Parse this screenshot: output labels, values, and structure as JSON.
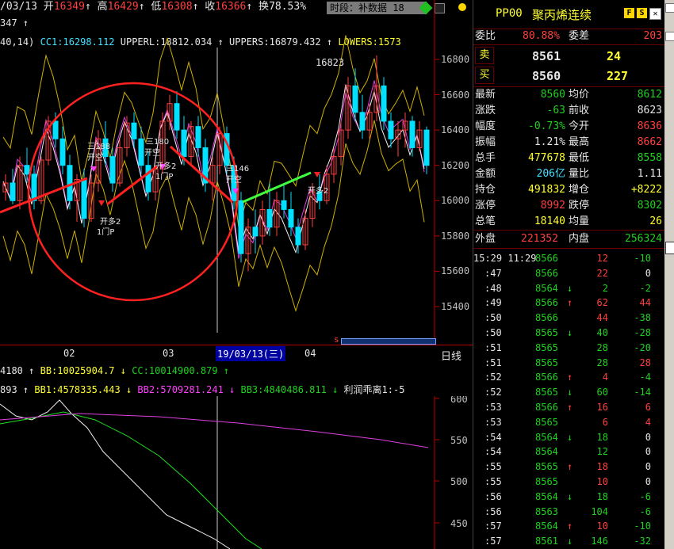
{
  "header": {
    "date": "/03/13",
    "open_label": "开",
    "open": "16349",
    "open_arrow": "↑",
    "high_label": "高",
    "high": "16429",
    "high_arrow": "↑",
    "low_label": "低",
    "low": "16308",
    "low_arrow": "↑",
    "close_label": "收",
    "close": "16366",
    "close_arrow": "↑",
    "turnover_label": "换",
    "turnover": "78.53%",
    "overlay_text": "时段：补数据",
    "overlay_tail": "18"
  },
  "indicator_line": {
    "left_num": "347 ↑",
    "params": "40,14)",
    "cc1": "CC1:16298.112",
    "upperl": "UPPERL:18812.034",
    "uppers": "UPPERS:16879.432",
    "lowers": "LOWERS:1573"
  },
  "price_axis": {
    "ticks": [
      "16800",
      "16600",
      "16400",
      "16200",
      "16000",
      "15800",
      "15600",
      "15400"
    ]
  },
  "chart_annotations": {
    "peak_label": "16823",
    "marks": [
      "三188",
      "开空",
      "开多2",
      "1门P",
      "三180",
      "开空",
      "开多2",
      "1门P",
      "三146",
      "开空",
      "开多2"
    ]
  },
  "date_axis": {
    "labels": [
      "02",
      "03",
      "19/03/13(三)",
      "04"
    ],
    "period_label": "日线"
  },
  "lower_header_1": {
    "left": "4180 ↑",
    "bb": "BB:10025904.7 ↓",
    "cc": "CC:10014900.879 ↑"
  },
  "lower_header_2": {
    "left": "893 ↑",
    "bb1": "BB1:4578335.443 ↓",
    "bb2": "BB2:5709281.241 ↓",
    "bb3": "BB3:4840486.811 ↓",
    "lr": "利润乖离1:-5"
  },
  "lower_axis": {
    "ticks": [
      "600",
      "550",
      "500",
      "450"
    ]
  },
  "panel": {
    "symbol": "PP00",
    "name": "聚丙烯连续",
    "btn_f": "F",
    "btn_s": "S",
    "ratio_label": "委比",
    "ratio": "80.88%",
    "diff_label": "委差",
    "diff": "203",
    "sell_label": "卖",
    "sell_price": "8561",
    "sell_qty": "24",
    "buy_label": "买",
    "buy_price": "8560",
    "buy_qty": "227",
    "stats": [
      {
        "l1": "最新",
        "v1": "8560",
        "l2": "均价",
        "v2": "8612",
        "c1": "green",
        "c2": "green"
      },
      {
        "l1": "涨跌",
        "v1": "-63",
        "l2": "前收",
        "v2": "8623",
        "c1": "green",
        "c2": "white"
      },
      {
        "l1": "幅度",
        "v1": "-0.73%",
        "l2": "今开",
        "v2": "8636",
        "c1": "green",
        "c2": "red"
      },
      {
        "l1": "振幅",
        "v1": "1.21%",
        "l2": "最高",
        "v2": "8662",
        "c1": "white",
        "c2": "red"
      },
      {
        "l1": "总手",
        "v1": "477678",
        "l2": "最低",
        "v2": "8558",
        "c1": "yellow",
        "c2": "green"
      },
      {
        "l1": "金额",
        "v1": "206亿",
        "l2": "量比",
        "v2": "1.11",
        "c1": "cyan",
        "c2": "white"
      },
      {
        "l1": "持仓",
        "v1": "491832",
        "l2": "增仓",
        "v2": "+8222",
        "c1": "yellow",
        "c2": "yellow"
      },
      {
        "l1": "涨停",
        "v1": "8992",
        "l2": "跌停",
        "v2": "8302",
        "c1": "red",
        "c2": "green"
      },
      {
        "l1": "总笔",
        "v1": "18140",
        "l2": "均量",
        "v2": "26",
        "c1": "yellow",
        "c2": "yellow"
      }
    ],
    "outer_label": "外盘",
    "outer": "221352",
    "inner_label": "内盘",
    "inner": "256324",
    "ticks": [
      {
        "t": "15:29 11:29",
        "p": "8566",
        "arrow": "",
        "v": "12",
        "d": "-10",
        "pc": "green",
        "vc": "red",
        "dc": "green"
      },
      {
        "t": ":47",
        "p": "8566",
        "arrow": "",
        "v": "22",
        "d": "0",
        "pc": "green",
        "vc": "red",
        "dc": "white"
      },
      {
        "t": ":48",
        "p": "8564",
        "arrow": "↓",
        "v": "2",
        "d": "-2",
        "pc": "green",
        "vc": "green",
        "dc": "green"
      },
      {
        "t": ":49",
        "p": "8566",
        "arrow": "↑",
        "v": "62",
        "d": "44",
        "pc": "green",
        "vc": "red",
        "dc": "red"
      },
      {
        "t": ":50",
        "p": "8566",
        "arrow": "",
        "v": "44",
        "d": "-38",
        "pc": "green",
        "vc": "red",
        "dc": "green"
      },
      {
        "t": ":50",
        "p": "8565",
        "arrow": "↓",
        "v": "40",
        "d": "-28",
        "pc": "green",
        "vc": "green",
        "dc": "green"
      },
      {
        "t": ":51",
        "p": "8565",
        "arrow": "",
        "v": "28",
        "d": "-20",
        "pc": "green",
        "vc": "green",
        "dc": "green"
      },
      {
        "t": ":51",
        "p": "8565",
        "arrow": "",
        "v": "28",
        "d": "28",
        "pc": "green",
        "vc": "green",
        "dc": "red"
      },
      {
        "t": ":52",
        "p": "8566",
        "arrow": "↑",
        "v": "4",
        "d": "-4",
        "pc": "green",
        "vc": "red",
        "dc": "green"
      },
      {
        "t": ":52",
        "p": "8565",
        "arrow": "↓",
        "v": "60",
        "d": "-14",
        "pc": "green",
        "vc": "green",
        "dc": "green"
      },
      {
        "t": ":53",
        "p": "8566",
        "arrow": "↑",
        "v": "16",
        "d": "6",
        "pc": "green",
        "vc": "red",
        "dc": "red"
      },
      {
        "t": ":53",
        "p": "8565",
        "arrow": "",
        "v": "6",
        "d": "4",
        "pc": "green",
        "vc": "red",
        "dc": "red"
      },
      {
        "t": ":54",
        "p": "8564",
        "arrow": "↓",
        "v": "18",
        "d": "0",
        "pc": "green",
        "vc": "green",
        "dc": "white"
      },
      {
        "t": ":54",
        "p": "8564",
        "arrow": "",
        "v": "12",
        "d": "0",
        "pc": "green",
        "vc": "green",
        "dc": "white"
      },
      {
        "t": ":55",
        "p": "8565",
        "arrow": "↑",
        "v": "18",
        "d": "0",
        "pc": "green",
        "vc": "red",
        "dc": "white"
      },
      {
        "t": ":55",
        "p": "8565",
        "arrow": "",
        "v": "10",
        "d": "0",
        "pc": "green",
        "vc": "red",
        "dc": "white"
      },
      {
        "t": ":56",
        "p": "8564",
        "arrow": "↓",
        "v": "18",
        "d": "-6",
        "pc": "green",
        "vc": "green",
        "dc": "green"
      },
      {
        "t": ":56",
        "p": "8563",
        "arrow": "",
        "v": "104",
        "d": "-6",
        "pc": "green",
        "vc": "green",
        "dc": "green"
      },
      {
        "t": ":57",
        "p": "8564",
        "arrow": "↑",
        "v": "10",
        "d": "-10",
        "pc": "green",
        "vc": "red",
        "dc": "green"
      },
      {
        "t": ":57",
        "p": "8561",
        "arrow": "↓",
        "v": "146",
        "d": "-32",
        "pc": "green",
        "vc": "green",
        "dc": "green"
      }
    ]
  },
  "colors": {
    "up": "#ff4040",
    "down": "#00e0ff",
    "green": "#20d020",
    "yellow": "#ffff30",
    "cyan": "#40e0ff",
    "mag": "#ff40ff",
    "ann": "#ff2020"
  },
  "chart_data": {
    "type": "candlestick",
    "price_ticks": [
      16800,
      16600,
      16400,
      16200,
      16000,
      15800,
      15600,
      15400
    ],
    "peak": 16823,
    "candles": [
      [
        16050,
        16150,
        16000,
        16100
      ],
      [
        16100,
        16180,
        15980,
        16000
      ],
      [
        16000,
        16250,
        15950,
        16200
      ],
      [
        16200,
        16300,
        16100,
        16150
      ],
      [
        16150,
        16200,
        15950,
        16000
      ],
      [
        16000,
        16250,
        15980,
        16230
      ],
      [
        16230,
        16480,
        16200,
        16450
      ],
      [
        16450,
        16500,
        16300,
        16350
      ],
      [
        16350,
        16420,
        16150,
        16200
      ],
      [
        16200,
        16260,
        15950,
        16000
      ],
      [
        16000,
        16150,
        15880,
        16120
      ],
      [
        16120,
        16180,
        15850,
        15900
      ],
      [
        15900,
        16150,
        15880,
        16100
      ],
      [
        16100,
        16400,
        16050,
        16350
      ],
      [
        16350,
        16450,
        16200,
        16250
      ],
      [
        16250,
        16300,
        16050,
        16100
      ],
      [
        16100,
        16350,
        16080,
        16300
      ],
      [
        16300,
        16480,
        16250,
        16440
      ],
      [
        16440,
        16500,
        16300,
        16350
      ],
      [
        16350,
        16420,
        16150,
        16200
      ],
      [
        16200,
        16280,
        16000,
        16050
      ],
      [
        16050,
        16200,
        16000,
        16180
      ],
      [
        16180,
        16500,
        16150,
        16450
      ],
      [
        16450,
        16600,
        16400,
        16550
      ],
      [
        16550,
        16620,
        16350,
        16400
      ],
      [
        16400,
        16480,
        16200,
        16250
      ],
      [
        16250,
        16450,
        16200,
        16420
      ],
      [
        16420,
        16480,
        16250,
        16300
      ],
      [
        16300,
        16350,
        16050,
        16100
      ],
      [
        16100,
        16250,
        16000,
        16200
      ],
      [
        16200,
        16420,
        16150,
        16380
      ],
      [
        16380,
        16420,
        16150,
        16200
      ],
      [
        16200,
        16250,
        15950,
        16000
      ],
      [
        16000,
        16050,
        15650,
        15700
      ],
      [
        15700,
        15900,
        15600,
        15850
      ],
      [
        15850,
        15950,
        15700,
        15800
      ],
      [
        15800,
        16000,
        15750,
        15950
      ],
      [
        15950,
        16100,
        15800,
        15850
      ],
      [
        15850,
        16050,
        15800,
        16000
      ],
      [
        16000,
        16100,
        15900,
        15950
      ],
      [
        15950,
        16050,
        15800,
        15850
      ],
      [
        15850,
        15900,
        15700,
        15750
      ],
      [
        15750,
        15950,
        15720,
        15900
      ],
      [
        15900,
        16100,
        15850,
        16050
      ],
      [
        16050,
        16150,
        15950,
        16000
      ],
      [
        16000,
        16200,
        15980,
        16150
      ],
      [
        16150,
        16300,
        16100,
        16250
      ],
      [
        16250,
        16450,
        16200,
        16400
      ],
      [
        16400,
        16700,
        16350,
        16650
      ],
      [
        16650,
        16750,
        16450,
        16500
      ],
      [
        16500,
        16600,
        16350,
        16400
      ],
      [
        16400,
        16550,
        16350,
        16500
      ],
      [
        16500,
        16823,
        16450,
        16650
      ],
      [
        16650,
        16700,
        16400,
        16450
      ],
      [
        16450,
        16500,
        16300,
        16350
      ],
      [
        16350,
        16450,
        16250,
        16400
      ],
      [
        16400,
        16500,
        16300,
        16450
      ],
      [
        16450,
        16480,
        16250,
        16300
      ],
      [
        16300,
        16450,
        16280,
        16400
      ],
      [
        16400,
        16420,
        16150,
        16200
      ]
    ]
  }
}
